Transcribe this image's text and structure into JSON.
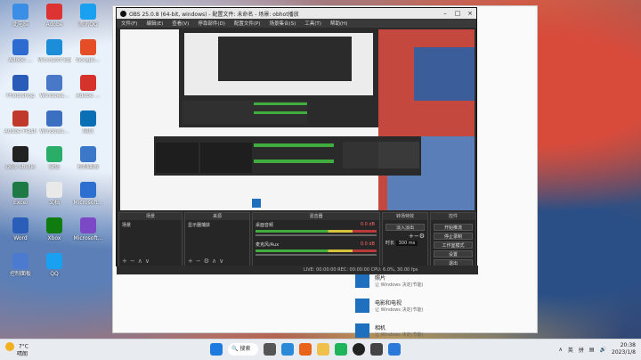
{
  "desktop": {
    "icons": [
      {
        "label": "此电脑",
        "color": "#3a8ee6"
      },
      {
        "label": "Adobe",
        "color": "#d33"
      },
      {
        "label": "腾讯QQ",
        "color": "#1aa0f0"
      },
      {
        "label": "Adobe ...",
        "color": "#2d6bd1"
      },
      {
        "label": "Microsoft Edge",
        "color": "#1c8dd9"
      },
      {
        "label": "Google...",
        "color": "#e44d26"
      },
      {
        "label": "Photoshop",
        "color": "#2a5bb8"
      },
      {
        "label": "Windows...",
        "color": "#4a78c9"
      },
      {
        "label": "Adobe ...",
        "color": "#d6322c"
      },
      {
        "label": "Adobe Flash",
        "color": "#c0392b"
      },
      {
        "label": "Windows...",
        "color": "#3b6fc2"
      },
      {
        "label": "网页",
        "color": "#0b6fb5"
      },
      {
        "label": "OBS Studio",
        "color": "#222"
      },
      {
        "label": "微信",
        "color": "#2aae67"
      },
      {
        "label": "控制面板",
        "color": "#3b78c9"
      },
      {
        "label": "Excel",
        "color": "#1e7a45"
      },
      {
        "label": "文档",
        "color": "#e9e9e9"
      },
      {
        "label": "Microsoft...",
        "color": "#2c6fd0"
      },
      {
        "label": "Word",
        "color": "#2b5eb8"
      },
      {
        "label": "Xbox",
        "color": "#107c10"
      },
      {
        "label": "Microsoft...",
        "color": "#7b49c6"
      },
      {
        "label": "控制面板",
        "color": "#4a7bd1"
      },
      {
        "label": "QQ",
        "color": "#1aa0f0"
      }
    ]
  },
  "background_window": {
    "items": [
      {
        "title": "照片",
        "subtitle": "让 Windows 决定(节能)"
      },
      {
        "title": "电影和电视",
        "subtitle": "让 Windows 决定(节能)"
      },
      {
        "title": "相机",
        "subtitle": "让 Windows 决定(节能)"
      }
    ]
  },
  "obs": {
    "title": "OBS 25.0.8 (64-bit, windows) - 配置文件: 未命名 - 场景: obhot播放",
    "menu": [
      "文件(F)",
      "编辑(E)",
      "查看(V)",
      "停靠部件(D)",
      "配置文件(P)",
      "场景集合(S)",
      "工具(T)",
      "帮助(H)"
    ],
    "docks": {
      "scenes": {
        "title": "场景",
        "item": "场景"
      },
      "sources": {
        "title": "来源",
        "item": "显示器捕获"
      },
      "mixer": {
        "title": "混音器",
        "channels": [
          {
            "name": "桌面音频",
            "value": "0.0 dB"
          },
          {
            "name": "麦克风/Aux",
            "value": "0.0 dB"
          }
        ]
      },
      "transitions": {
        "title": "转场特效",
        "type": "淡入淡出",
        "duration_label": "时长",
        "duration": "300 ms"
      },
      "controls": {
        "title": "控件",
        "buttons": [
          "开始推流",
          "停止录制",
          "工作室模式",
          "设置",
          "退出"
        ]
      }
    },
    "status": "LIVE: 00:00:00   REC: 00:00:00   CPU: 6.0%, 30.00 fps"
  },
  "taskbar": {
    "weather_temp": "7°C",
    "weather_desc": "晴朗",
    "search_label": "搜索",
    "ime": "英",
    "ime2": "拼",
    "time": "20:38",
    "date": "2023/1/8"
  }
}
